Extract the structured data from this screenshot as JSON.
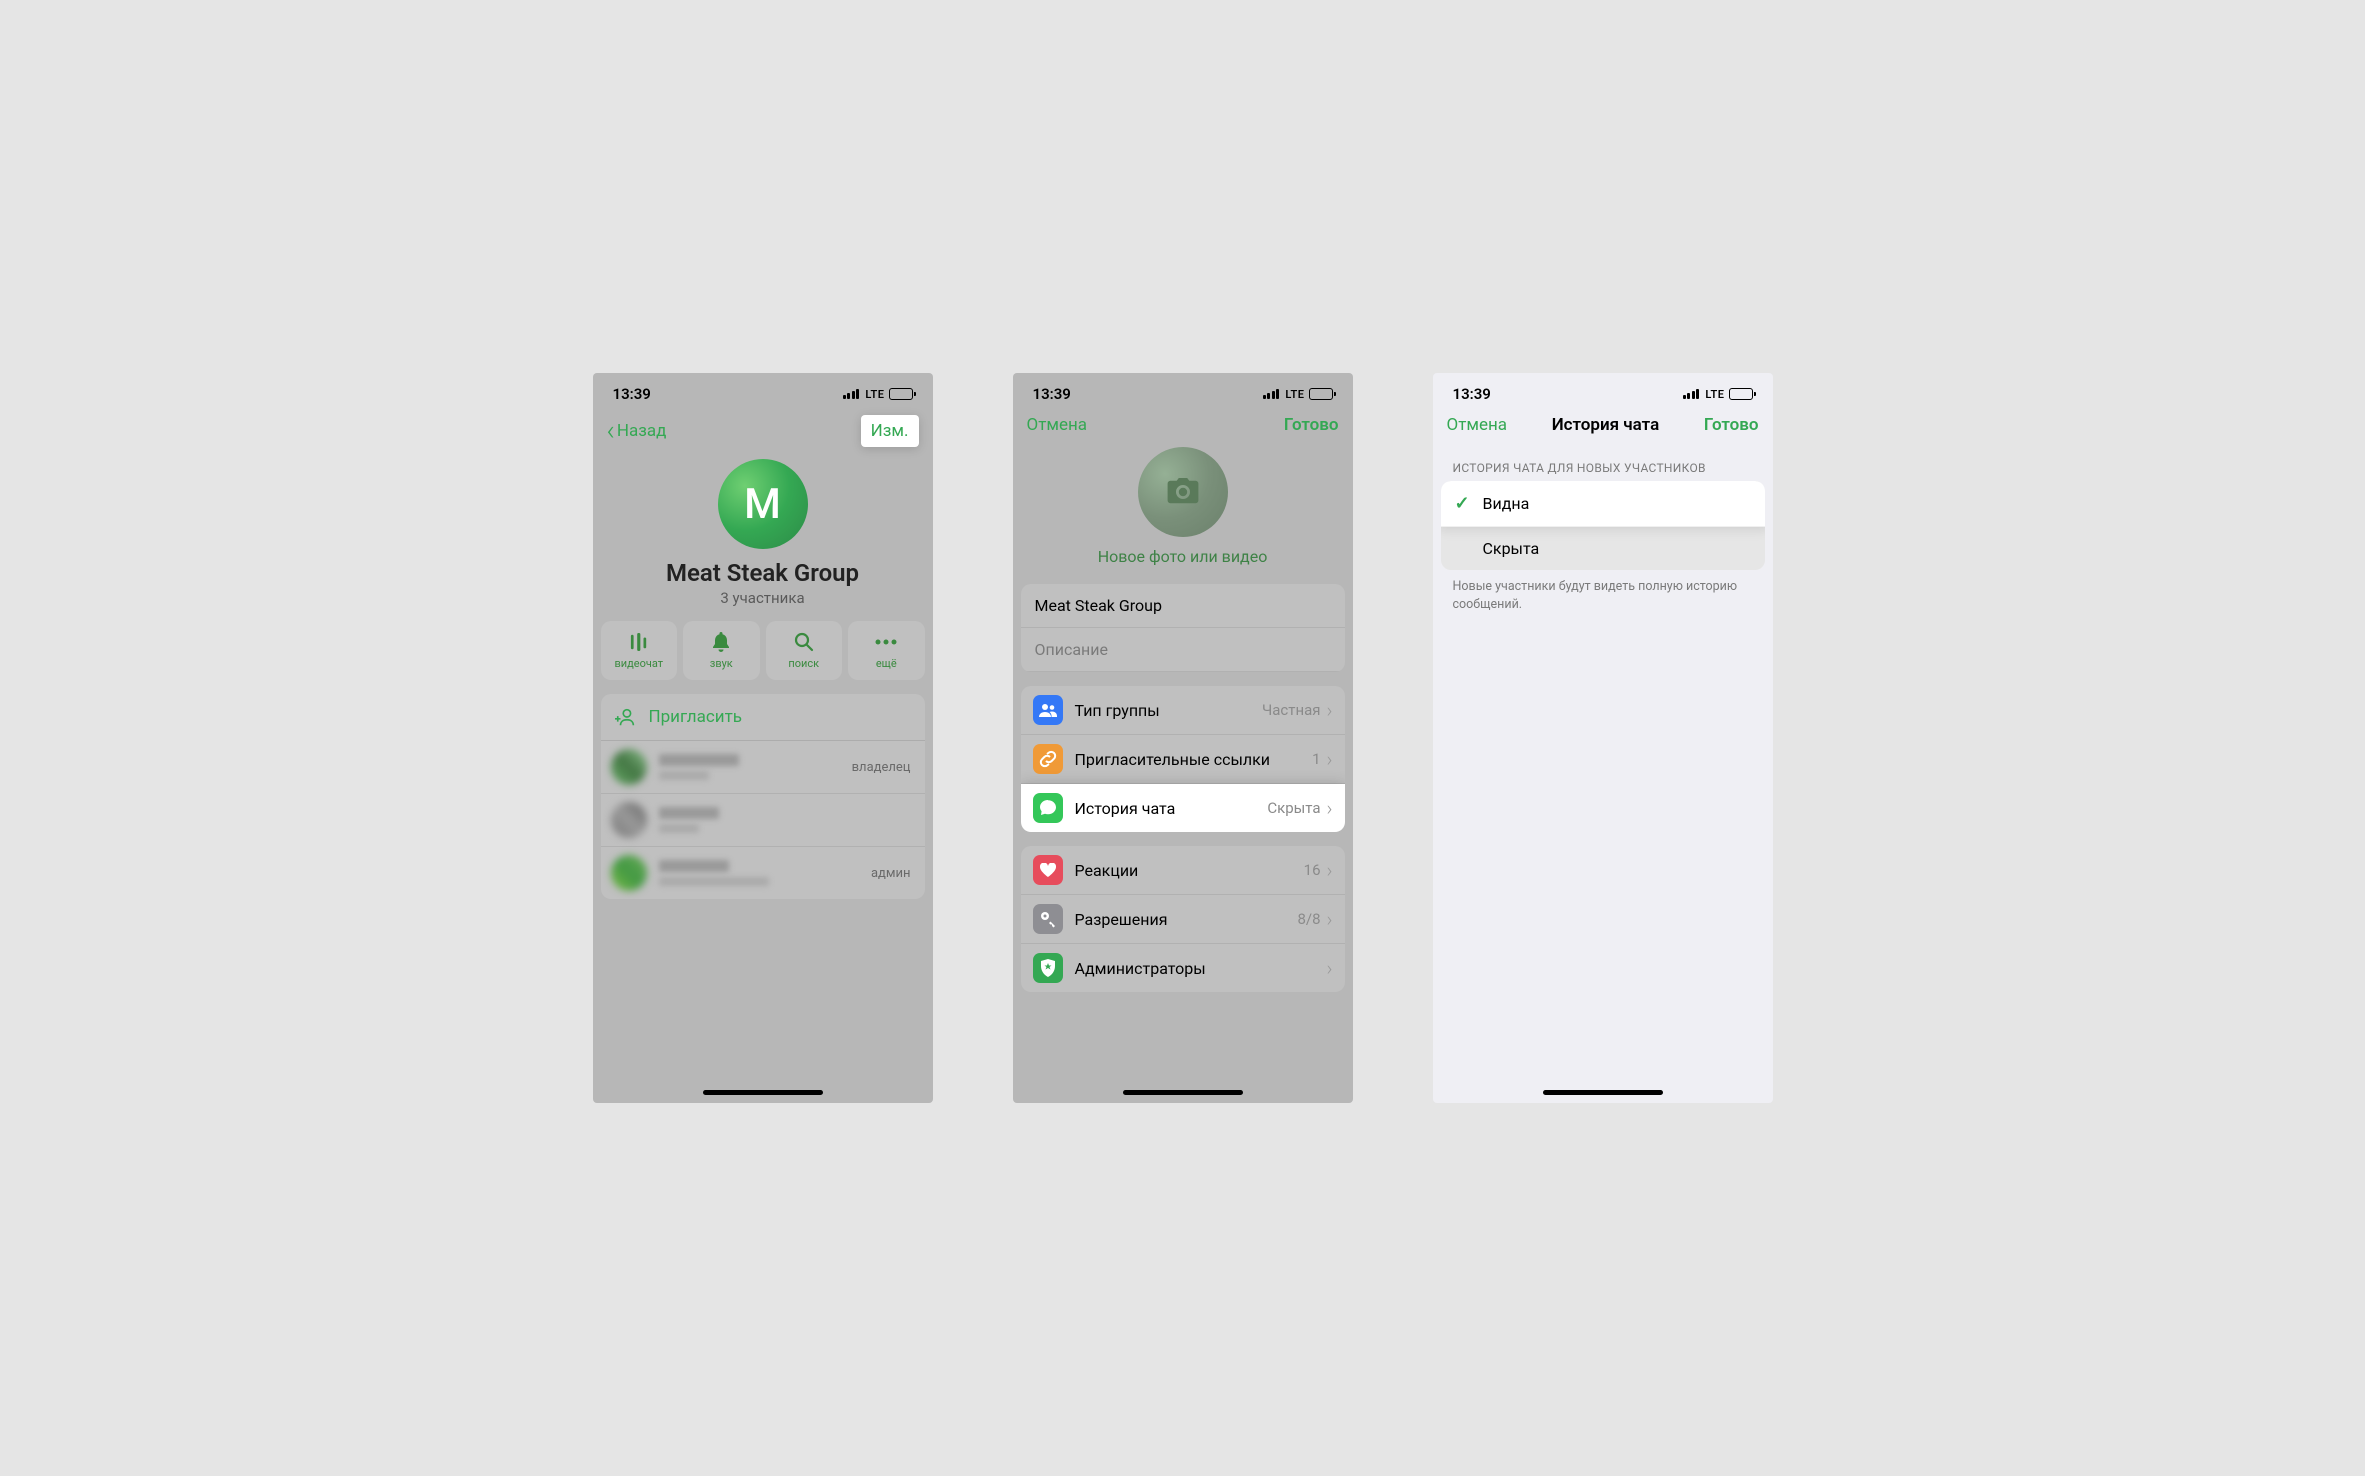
{
  "status": {
    "time": "13:39",
    "network": "LTE"
  },
  "screen1": {
    "back": "Назад",
    "edit": "Изм.",
    "avatar_letter": "M",
    "title": "Meat Steak Group",
    "subtitle": "3 участника",
    "actions": {
      "video": "видеочат",
      "sound": "звук",
      "search": "поиск",
      "more": "ещё"
    },
    "invite": "Пригласить",
    "roles": {
      "owner": "владелец",
      "admin": "админ"
    }
  },
  "screen2": {
    "cancel": "Отмена",
    "done": "Готово",
    "photo_link": "Новое фото или видео",
    "name_value": "Meat Steak Group",
    "desc_placeholder": "Описание",
    "rows": {
      "type": {
        "label": "Тип группы",
        "value": "Частная"
      },
      "links": {
        "label": "Пригласительные ссылки",
        "value": "1"
      },
      "history": {
        "label": "История чата",
        "value": "Скрыта"
      },
      "reactions": {
        "label": "Реакции",
        "value": "16"
      },
      "permissions": {
        "label": "Разрешения",
        "value": "8/8"
      },
      "admins": {
        "label": "Администраторы",
        "value": ""
      }
    }
  },
  "screen3": {
    "cancel": "Отмена",
    "title": "История чата",
    "done": "Готово",
    "section_header": "ИСТОРИЯ ЧАТА ДЛЯ НОВЫХ УЧАСТНИКОВ",
    "options": {
      "visible": "Видна",
      "hidden": "Скрыта"
    },
    "footer": "Новые участники будут видеть полную историю сообщений."
  }
}
